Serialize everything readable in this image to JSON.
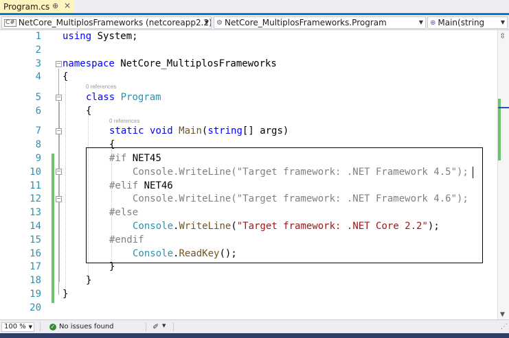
{
  "tab": {
    "title": "Program.cs",
    "pin": "⊕",
    "close": "×"
  },
  "nav": {
    "project": "NetCore_MultiplosFrameworks (netcoreapp2.2)",
    "project_icon": "C#",
    "type": "NetCore_MultiplosFrameworks.Program",
    "type_icon": "⚙",
    "member": "Main(string",
    "member_icon": "⊕"
  },
  "code": {
    "lines": [
      "1",
      "2",
      "3",
      "4",
      "5",
      "6",
      "7",
      "8",
      "9",
      "10",
      "11",
      "12",
      "13",
      "14",
      "15",
      "16",
      "17",
      "18",
      "19",
      "20"
    ],
    "l1_kw": "using",
    "l1_rest": " System;",
    "l3_kw": "namespace",
    "l3_rest": " NetCore_MultiplosFrameworks",
    "l4": "{",
    "lens_class": "0 references",
    "l5_kw": "class",
    "l5_type": "Program",
    "l6": "{",
    "lens_main": "0 references",
    "l7_kw1": "static",
    "l7_kw2": "void",
    "l7_method": "Main",
    "l7_p1": "(",
    "l7_kw3": "string",
    "l7_rest": "[] args)",
    "l8": "{",
    "l9_pp": "#if",
    "l9_sym": " NET45",
    "l10": "Console.WriteLine(\"Target framework: .NET Framework 4.5\");",
    "l11_pp": "#elif",
    "l11_sym": " NET46",
    "l12": "Console.WriteLine(\"Target framework: .NET Framework 4.6\");",
    "l13_pp": "#else",
    "l14_type": "Console",
    "l14_dot": ".",
    "l14_method": "WriteLine",
    "l14_p1": "(",
    "l14_str": "\"Target framework: .NET Core 2.2\"",
    "l14_end": ");",
    "l15_pp": "#endif",
    "l16_type": "Console",
    "l16_dot": ".",
    "l16_method": "ReadKey",
    "l16_end": "();",
    "l17": "}",
    "l18": "}",
    "l19": "}"
  },
  "status": {
    "zoom": "100 %",
    "issues": "No issues found"
  },
  "colors": {
    "accent": "#007acc",
    "keyword": "#0000ff",
    "type": "#2b91af",
    "string": "#a31515",
    "change": "#6ac46a"
  }
}
